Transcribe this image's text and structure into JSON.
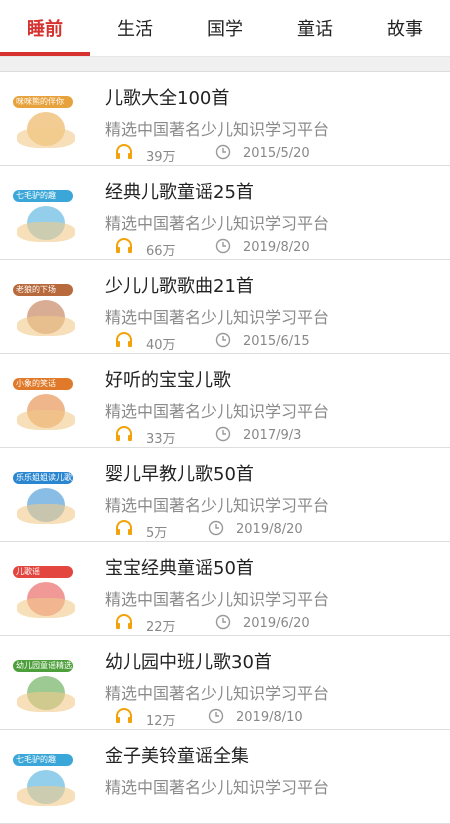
{
  "tabs": [
    {
      "label": "睡前",
      "active": true
    },
    {
      "label": "生活",
      "active": false
    },
    {
      "label": "国学",
      "active": false
    },
    {
      "label": "童话",
      "active": false
    },
    {
      "label": "故事",
      "active": false
    }
  ],
  "accent_color": "#d6322f",
  "icons": {
    "plays": "headphones-icon",
    "date": "clock-icon"
  },
  "items": [
    {
      "title": "儿歌大全100首",
      "subtitle": "精选中国著名少儿知识学习平台",
      "plays": "39万",
      "date": "2015/5/20",
      "thumb_label": "咪咪熊的伴你",
      "thumb_color": "#e8a23b"
    },
    {
      "title": "经典儿歌童谣25首",
      "subtitle": "精选中国著名少儿知识学习平台",
      "plays": "66万",
      "date": "2019/8/20",
      "thumb_label": "七毛驴的趣",
      "thumb_color": "#3aa7d8"
    },
    {
      "title": "少儿儿歌歌曲21首",
      "subtitle": "精选中国著名少儿知识学习平台",
      "plays": "40万",
      "date": "2015/6/15",
      "thumb_label": "老狼的下场",
      "thumb_color": "#b86a3c"
    },
    {
      "title": "好听的宝宝儿歌",
      "subtitle": "精选中国著名少儿知识学习平台",
      "plays": "33万",
      "date": "2017/9/3",
      "thumb_label": "小象的笑话",
      "thumb_color": "#e07a2a"
    },
    {
      "title": "婴儿早教儿歌50首",
      "subtitle": "精选中国著名少儿知识学习平台",
      "plays": "5万",
      "date": "2019/8/20",
      "thumb_label": "乐乐姐姐读儿歌",
      "thumb_color": "#2a86d0"
    },
    {
      "title": "宝宝经典童谣50首",
      "subtitle": "精选中国著名少儿知识学习平台",
      "plays": "22万",
      "date": "2019/6/20",
      "thumb_label": "儿歌谣",
      "thumb_color": "#e3463f"
    },
    {
      "title": "幼儿园中班儿歌30首",
      "subtitle": "精选中国著名少儿知识学习平台",
      "plays": "12万",
      "date": "2019/8/10",
      "thumb_label": "幼儿园童谣精选",
      "thumb_color": "#4c9f3a"
    },
    {
      "title": "金子美铃童谣全集",
      "subtitle": "精选中国著名少儿知识学习平台",
      "plays": "",
      "date": "",
      "thumb_label": "七毛驴的趣",
      "thumb_color": "#3aa7d8"
    }
  ]
}
